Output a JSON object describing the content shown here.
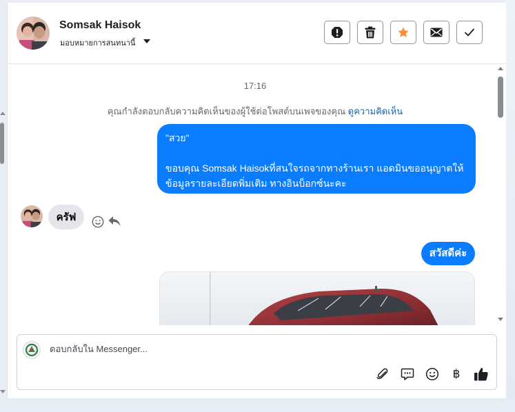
{
  "header": {
    "contact_name": "Somsak Haisok",
    "assign_label": "มอบหมายการสนทนานี้",
    "actions": [
      {
        "name": "report-icon"
      },
      {
        "name": "trash-icon"
      },
      {
        "name": "star-icon"
      },
      {
        "name": "envelope-icon"
      },
      {
        "name": "check-icon"
      }
    ]
  },
  "conversation": {
    "timestamp": "17:16",
    "system_note": "คุณกำลังตอบกลับความคิดเห็นของผู้ใช้ต่อโพสต์บนเพจของคุณ",
    "system_link": "ดูความคิดเห็น",
    "messages": [
      {
        "quote": "\"สวย\"",
        "text": "ขอบคุณ Somsak Haisokที่สนใจรถจากทางร้านเรา แอดมินขออนุญาตให้ข้อมูลรายละเอียดพิ่มเติม ทางอินบ็อกซ์นะคะ"
      },
      {
        "text": "ครัฟ"
      },
      {
        "text": "สวัสดีค่ะ"
      }
    ]
  },
  "composer": {
    "placeholder": "ตอบกลับใน Messenger...",
    "tools": [
      "paperclip-icon",
      "speech-bubble-icon",
      "smiley-icon",
      "baht-icon",
      "thumbs-up-icon"
    ],
    "baht_symbol": "฿"
  },
  "colors": {
    "accent": "#0a7cff",
    "star": "#f7923a",
    "link": "#0a66c2"
  }
}
